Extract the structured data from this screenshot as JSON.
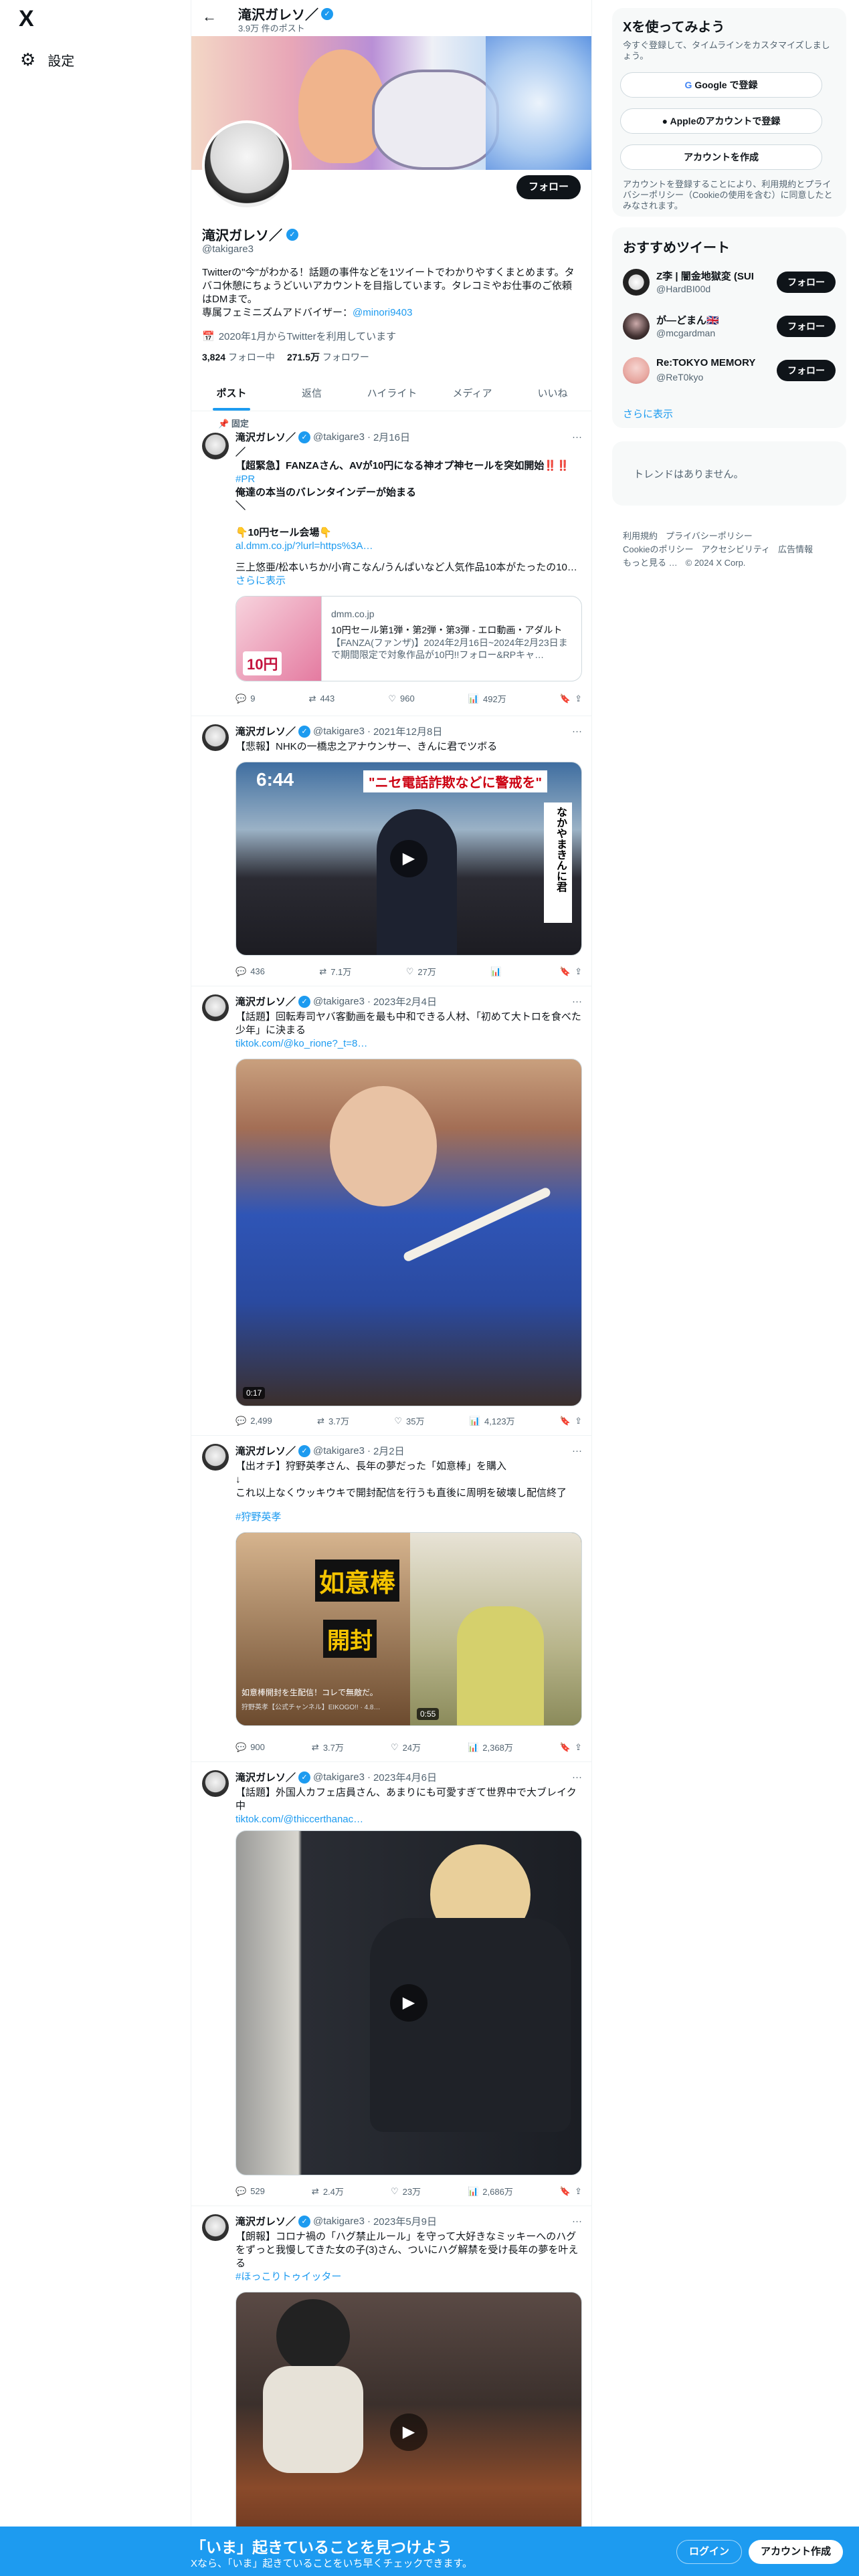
{
  "app": {
    "logo": "X",
    "settings_label": "設定"
  },
  "profile": {
    "name": "滝沢ガレソ／",
    "post_count": "3.9万 件のポスト",
    "handle": "@takigare3",
    "bio": "Twitterの\"今\"がわかる！話題の事件などを1ツイートでわかりやすくまとめます。タバコ休憩にちょうどいいアカウントを目指しています。タレコミやお仕事のご依頼はDMまで。\n専属フェミニズムアドバイザー：",
    "bio_link": "@minori9403",
    "joined": "2020年1月からTwitterを利用しています",
    "following_count": "3,824",
    "following_label": "フォロー中",
    "followers_count": "271.5万",
    "followers_label": "フォロワー",
    "follow_button": "フォロー"
  },
  "tabs": [
    {
      "label": "ポスト",
      "active": true
    },
    {
      "label": "返信"
    },
    {
      "label": "ハイライト"
    },
    {
      "label": "メディア"
    },
    {
      "label": "いいね"
    }
  ],
  "tweets": [
    {
      "pinned": "固定",
      "name": "滝沢ガレソ／",
      "handle": "@takigare3",
      "date": "2月16日",
      "text": "／\n【超緊急】FANZAさん、AVが10円になる神オプ神セールを突如開始‼️‼️",
      "tag": "#PR",
      "text2": "俺達の本当のバレンタインデーが始まる\n＼\n\n👇10円セール会場👇",
      "link": "al.dmm.co.jp/?lurl=https%3A…",
      "text3": "三上悠亜/松本いちか/小宵こなん/うんぱいなど人気作品10本がたったの10…",
      "more": "さらに表示",
      "card": {
        "domain": "dmm.co.jp",
        "title": "10円セール第1弾・第2弾・第3弾 - エロ動画・アダルト",
        "desc": "【FANZA(ファンザ)】2024年2月16日~2024年2月23日まで期間限定で対象作品が10円!!フォロー&RPキャ…",
        "price": "10円"
      },
      "replies": "9",
      "retweets": "443",
      "likes": "960",
      "views": "492万"
    },
    {
      "name": "滝沢ガレソ／",
      "handle": "@takigare3",
      "date": "2021年12月8日",
      "text": "【悲報】NHKの一橋忠之アナウンサー、きんに君でツボる",
      "overlay_top": "\"ニセ電話詐欺などに警戒を\"",
      "overlay_time": "6:44",
      "overlay_side": "なかやまきんに君",
      "replies": "436",
      "retweets": "7.1万",
      "likes": "27万",
      "views": ""
    },
    {
      "name": "滝沢ガレソ／",
      "handle": "@takigare3",
      "date": "2023年2月4日",
      "text": "【話題】回転寿司ヤバ客動画を最も中和できる人材、「初めて大トロを食べた少年」に決まる",
      "link": "tiktok.com/@ko_rione?_t=8…",
      "duration": "0:17",
      "replies": "2,499",
      "retweets": "3.7万",
      "likes": "35万",
      "views": "4,123万"
    },
    {
      "name": "滝沢ガレソ／",
      "handle": "@takigare3",
      "date": "2月2日",
      "text": "【出オチ】狩野英孝さん、長年の夢だった「如意棒」を購入\n↓\nこれ以上なくウッキウキで開封配信を行うも直後に周明を破壊し配信終了",
      "tag": "#狩野英孝",
      "overlay_big": "如意棒",
      "overlay_sub": "開封",
      "caption": "如意棒開封を生配信！コレで無敵だ。",
      "caption2": "狩野英孝【公式チャンネル】EIKOGO!! · 4.8…",
      "duration": "0:55",
      "replies": "900",
      "retweets": "3.7万",
      "likes": "24万",
      "views": "2,368万"
    },
    {
      "name": "滝沢ガレソ／",
      "handle": "@takigare3",
      "date": "2023年4月6日",
      "text": "【話題】外国人カフェ店員さん、あまりにも可愛すぎて世界中で大ブレイク中",
      "link": "tiktok.com/@thiccerthanac…",
      "replies": "529",
      "retweets": "2.4万",
      "likes": "23万",
      "views": "2,686万"
    },
    {
      "name": "滝沢ガレソ／",
      "handle": "@takigare3",
      "date": "2023年5月9日",
      "text": "【朗報】コロナ禍の「ハグ禁止ルール」を守って大好きなミッキーへのハグをずっと我慢してきた女の子(3)さん、ついにハグ解禁を受け長年の夢を叶える",
      "tag": "#ほっこりトゥイッター"
    }
  ],
  "sidebar": {
    "signup": {
      "title": "Xを使ってみよう",
      "sub": "今すぐ登録して、タイムラインをカスタマイズしましょう。",
      "google": "Google で登録",
      "apple": "Appleのアカウントで登録",
      "create": "アカウントを作成",
      "terms": "アカウントを登録することにより、利用規約とプライバシーポリシー（Cookieの使用を含む）に同意したとみなされます。"
    },
    "recommend": {
      "title": "おすすめツイート",
      "items": [
        {
          "name": "Z李 | 闇金地獄変 (SUI",
          "handle": "@HardBI00d",
          "button": "フォロー"
        },
        {
          "name": "が―どまん🇬🇧",
          "handle": "@mcgardman",
          "button": "フォロー"
        },
        {
          "name": "Re:TOKYO MEMORY",
          "handle": "@ReT0kyo",
          "button": "フォロー"
        }
      ],
      "more": "さらに表示"
    },
    "trends_empty": "トレンドはありません。",
    "footer": [
      "利用規約",
      "プライバシーポリシー",
      "Cookieのポリシー",
      "アクセシビリティ",
      "広告情報",
      "もっと見る …",
      "© 2024 X Corp."
    ]
  },
  "bottom": {
    "title": "「いま」起きていることを見つけよう",
    "sub": "Xなら、「いま」起きていることをいち早くチェックできます。",
    "login": "ログイン",
    "signup": "アカウント作成"
  },
  "colors": {
    "accent": "#1d9bf0",
    "text": "#0f1419",
    "muted": "#536471"
  }
}
